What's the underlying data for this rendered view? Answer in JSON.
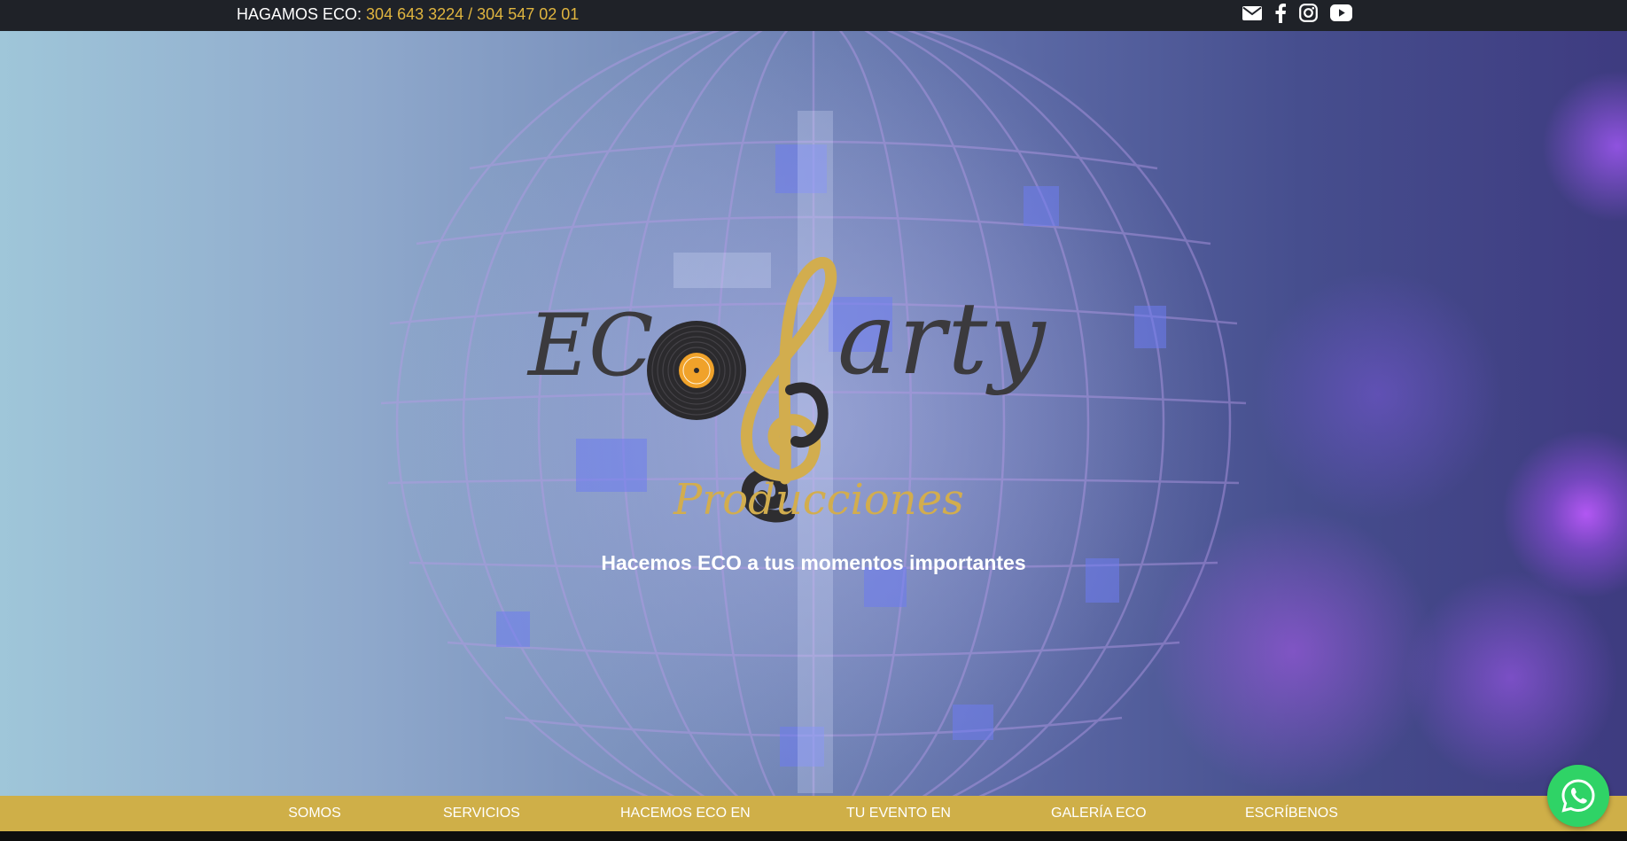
{
  "topbar": {
    "contact_label": "HAGAMOS ECO:",
    "phones": "304 643 3224 / 304 547 02 01",
    "social_icons": [
      "envelope-icon",
      "facebook-icon",
      "instagram-icon",
      "youtube-icon"
    ]
  },
  "hero": {
    "logo": {
      "word_left": "EC",
      "word_right": "arty",
      "subtitle": "Producciones"
    },
    "tagline": "Hacemos ECO a tus momentos importantes"
  },
  "nav": {
    "items": [
      {
        "label": "SOMOS"
      },
      {
        "label": "SERVICIOS"
      },
      {
        "label": "HACEMOS ECO EN"
      },
      {
        "label": "TU EVENTO EN"
      },
      {
        "label": "GALERÍA ECO"
      },
      {
        "label": "ESCRÍBENOS"
      }
    ]
  },
  "floating": {
    "icon": "whatsapp-icon"
  },
  "colors": {
    "topbar_bg": "#1f2228",
    "phone_accent": "#e0b53f",
    "nav_bg": "#cfaf48",
    "logo_dark": "#3b3a3d",
    "logo_gold": "#d2ad4e",
    "whatsapp_green": "#2fd366"
  }
}
